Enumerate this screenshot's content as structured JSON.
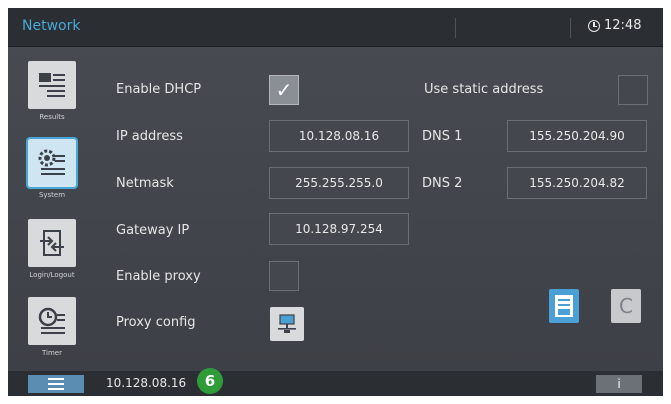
{
  "topbar": {
    "title": "Network",
    "time": "12:48"
  },
  "sidebar": {
    "items": [
      {
        "label": "Results",
        "icon": "results-icon",
        "active": false
      },
      {
        "label": "System",
        "icon": "system-gear-icon",
        "active": true
      },
      {
        "label": "Login/Logout",
        "icon": "login-logout-icon",
        "active": false
      },
      {
        "label": "Timer",
        "icon": "timer-icon",
        "active": false
      }
    ]
  },
  "form": {
    "enable_dhcp_label": "Enable DHCP",
    "enable_dhcp_checked": true,
    "use_static_label": "Use static address",
    "use_static_checked": false,
    "ip_label": "IP address",
    "ip_value": "10.128.08.16",
    "dns1_label": "DNS 1",
    "dns1_value": "155.250.204.90",
    "netmask_label": "Netmask",
    "netmask_value": "255.255.255.0",
    "dns2_label": "DNS 2",
    "dns2_value": "155.250.204.82",
    "gateway_label": "Gateway IP",
    "gateway_value": "10.128.97.254",
    "proxy_label": "Enable proxy",
    "proxy_checked": false,
    "proxy_config_label": "Proxy config"
  },
  "actions": {
    "save_icon": "save-icon",
    "cancel_label": "C"
  },
  "bottombar": {
    "status_ip": "10.128.08.16",
    "badge": "6",
    "info_label": "i"
  },
  "colors": {
    "accent": "#49a7d8",
    "badge": "#2f9c3a",
    "background": "#3a3d44"
  }
}
